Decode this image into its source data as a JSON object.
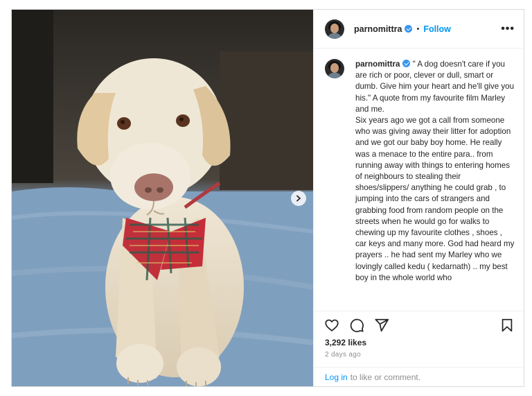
{
  "post": {
    "username": "parnomittra",
    "verified": true,
    "follow_label": "Follow",
    "separator": "•",
    "more_label": "•••",
    "caption": "\" A dog doesn't care if you are rich or poor, clever or dull, smart or dumb. Give him your heart and he'll give you his.\" A quote from my favourite film Marley and me.\nSix years ago we got a call from someone who was giving away their litter for adoption and we got our baby boy home. He really was a menace to the entire para.. from running away with things to entering homes of neighbours to stealing their shoes/slippers/ anything he could grab , to jumping into the cars of strangers and grabbing food from random people on the streets when he would go for walks to chewing up my favourite clothes , shoes , car keys and many more. God had heard my prayers .. he had sent my Marley who we lovingly called kedu ( kedarnath) .. my best boy in the whole world who",
    "likes": "3,292 likes",
    "time_ago": "2 days ago"
  },
  "footer": {
    "login_label": "Log in",
    "login_suffix": "to like or comment."
  },
  "icons": {
    "like": "heart-icon",
    "comment": "comment-icon",
    "share": "share-icon",
    "save": "bookmark-icon",
    "next": "chevron-right-icon"
  },
  "colors": {
    "accent": "#0095f6",
    "verified": "#3897f0",
    "muted": "#8e8e8e",
    "border": "#dbdbdb"
  }
}
